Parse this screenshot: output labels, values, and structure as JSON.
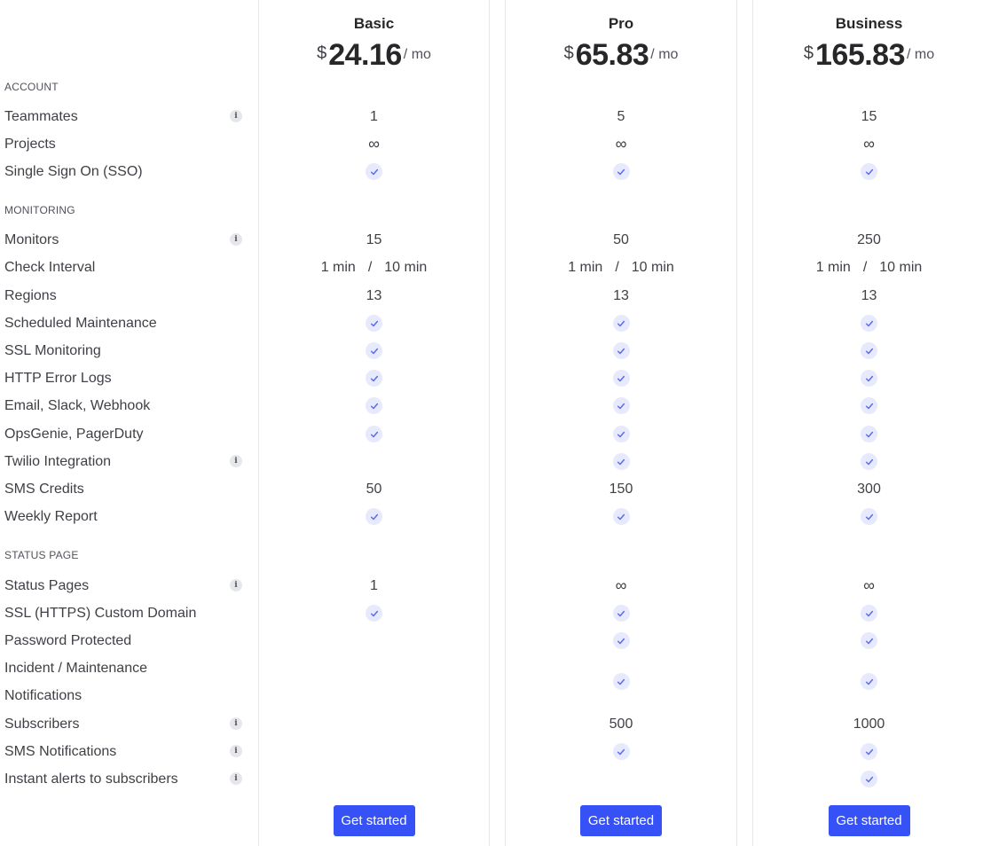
{
  "plans": [
    {
      "name": "Basic",
      "currency": "$",
      "price": "24.16",
      "period": "/ mo",
      "cta": "Get started"
    },
    {
      "name": "Pro",
      "currency": "$",
      "price": "65.83",
      "period": "/ mo",
      "cta": "Get started"
    },
    {
      "name": "Business",
      "currency": "$",
      "price": "165.83",
      "period": "/ mo",
      "cta": "Get started"
    }
  ],
  "colors": {
    "accent": "#3651f5",
    "check_bg": "#e7e9fd",
    "check_fg": "#5b6cf0"
  },
  "sections": [
    {
      "title": "ACCOUNT"
    },
    {
      "title": "MONITORING"
    },
    {
      "title": "STATUS PAGE"
    }
  ],
  "features": [
    {
      "label": "Teammates",
      "info": true,
      "values": [
        "1",
        "5",
        "15"
      ]
    },
    {
      "label": "Projects",
      "info": false,
      "values": [
        "∞",
        "∞",
        "∞"
      ]
    },
    {
      "label": "Single Sign On (SSO)",
      "info": false,
      "values": [
        "check",
        "check",
        "check"
      ]
    },
    {
      "label": "Monitors",
      "info": true,
      "values": [
        "15",
        "50",
        "250"
      ]
    },
    {
      "label": "Check Interval",
      "info": false,
      "values": [
        [
          "1 min",
          "/",
          "10 min"
        ],
        [
          "1 min",
          "/",
          "10 min"
        ],
        [
          "1 min",
          "/",
          "10 min"
        ]
      ]
    },
    {
      "label": "Regions",
      "info": false,
      "values": [
        "13",
        "13",
        "13"
      ]
    },
    {
      "label": "Scheduled Maintenance",
      "info": false,
      "values": [
        "check",
        "check",
        "check"
      ]
    },
    {
      "label": "SSL Monitoring",
      "info": false,
      "values": [
        "check",
        "check",
        "check"
      ]
    },
    {
      "label": "HTTP Error Logs",
      "info": false,
      "values": [
        "check",
        "check",
        "check"
      ]
    },
    {
      "label": "Email, Slack, Webhook",
      "info": false,
      "values": [
        "check",
        "check",
        "check"
      ]
    },
    {
      "label": "OpsGenie, PagerDuty",
      "info": false,
      "values": [
        "check",
        "check",
        "check"
      ]
    },
    {
      "label": "Twilio Integration",
      "info": true,
      "values": [
        "",
        "check",
        "check"
      ]
    },
    {
      "label": "SMS Credits",
      "info": false,
      "values": [
        "50",
        "150",
        "300"
      ]
    },
    {
      "label": "Weekly Report",
      "info": false,
      "values": [
        "check",
        "check",
        "check"
      ]
    },
    {
      "label": "Status Pages",
      "info": true,
      "values": [
        "1",
        "∞",
        "∞"
      ]
    },
    {
      "label": "SSL (HTTPS) Custom Domain",
      "info": false,
      "values": [
        "check",
        "check",
        "check"
      ]
    },
    {
      "label": "Password Protected",
      "info": false,
      "values": [
        "",
        "check",
        "check"
      ]
    },
    {
      "label": "Incident / Maintenance",
      "label2": "Notifications",
      "info": false,
      "values": [
        "",
        "check",
        "check"
      ]
    },
    {
      "label": "Subscribers",
      "info": true,
      "values": [
        "",
        "500",
        "1000"
      ]
    },
    {
      "label": "SMS Notifications",
      "info": true,
      "values": [
        "",
        "check",
        "check"
      ]
    },
    {
      "label": "Instant alerts to subscribers",
      "info": true,
      "values": [
        "",
        "",
        "check"
      ]
    }
  ]
}
